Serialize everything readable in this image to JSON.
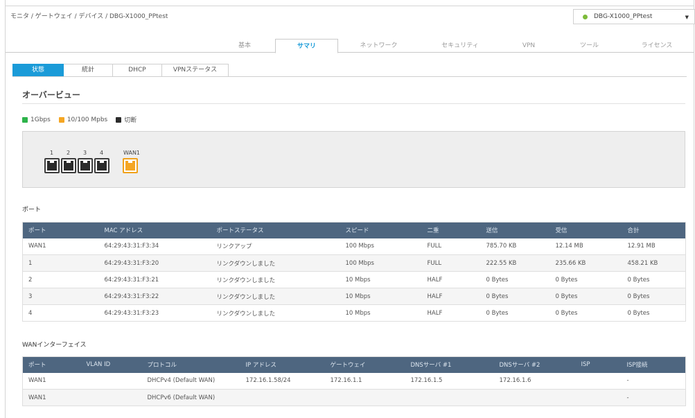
{
  "breadcrumb": "モニタ / ゲートウェイ / デバイス / DBG-X1000_PPtest",
  "device_select": {
    "value": "DBG-X1000_PPtest",
    "status_color": "#7dbb3a"
  },
  "main_tabs": [
    {
      "label": "基本",
      "active": false
    },
    {
      "label": "サマリ",
      "active": true
    },
    {
      "label": "ネットワーク",
      "active": false
    },
    {
      "label": "セキュリティ",
      "active": false
    },
    {
      "label": "VPN",
      "active": false
    },
    {
      "label": "ツール",
      "active": false
    },
    {
      "label": "ライセンス",
      "active": false
    }
  ],
  "sub_tabs": [
    {
      "label": "状態",
      "active": true
    },
    {
      "label": "統計",
      "active": false
    },
    {
      "label": "DHCP",
      "active": false
    },
    {
      "label": "VPNステータス",
      "active": false
    }
  ],
  "overview": {
    "title": "オーバービュー",
    "legend": [
      {
        "label": "1Gbps",
        "color": "#2db34a"
      },
      {
        "label": "10/100 Mpbs",
        "color": "#f5a623"
      },
      {
        "label": "切断",
        "color": "#2b2b2b"
      }
    ],
    "ports": [
      {
        "label": "1",
        "color": "dark"
      },
      {
        "label": "2",
        "color": "dark"
      },
      {
        "label": "3",
        "color": "dark"
      },
      {
        "label": "4",
        "color": "dark"
      },
      {
        "label": "WAN1",
        "color": "orange"
      }
    ]
  },
  "ports_table": {
    "title": "ポート",
    "headers": [
      "ポート",
      "MAC アドレス",
      "ポートステータス",
      "スピード",
      "二重",
      "送信",
      "受信",
      "合計"
    ],
    "rows": [
      [
        "WAN1",
        "64:29:43:31:F3:34",
        "リンクアップ",
        "100 Mbps",
        "FULL",
        "785.70 KB",
        "12.14 MB",
        "12.91 MB"
      ],
      [
        "1",
        "64:29:43:31:F3:20",
        "リンクダウンしました",
        "100 Mbps",
        "FULL",
        "222.55 KB",
        "235.66 KB",
        "458.21 KB"
      ],
      [
        "2",
        "64:29:43:31:F3:21",
        "リンクダウンしました",
        "10 Mbps",
        "HALF",
        "0 Bytes",
        "0 Bytes",
        "0 Bytes"
      ],
      [
        "3",
        "64:29:43:31:F3:22",
        "リンクダウンしました",
        "10 Mbps",
        "HALF",
        "0 Bytes",
        "0 Bytes",
        "0 Bytes"
      ],
      [
        "4",
        "64:29:43:31:F3:23",
        "リンクダウンしました",
        "10 Mbps",
        "HALF",
        "0 Bytes",
        "0 Bytes",
        "0 Bytes"
      ]
    ]
  },
  "wan_table": {
    "title": "WANインターフェイス",
    "headers": [
      "ポート",
      "VLAN ID",
      "プロトコル",
      "IP アドレス",
      "ゲートウェイ",
      "DNSサーバ #1",
      "DNSサーバ #2",
      "ISP",
      "ISP接続"
    ],
    "rows": [
      [
        "WAN1",
        "",
        "DHCPv4 (Default WAN)",
        "172.16.1.58/24",
        "172.16.1.1",
        "172.16.1.5",
        "172.16.1.6",
        "",
        "-"
      ],
      [
        "WAN1",
        "",
        "DHCPv6 (Default WAN)",
        "",
        "",
        "",
        "",
        "",
        "-"
      ]
    ]
  }
}
